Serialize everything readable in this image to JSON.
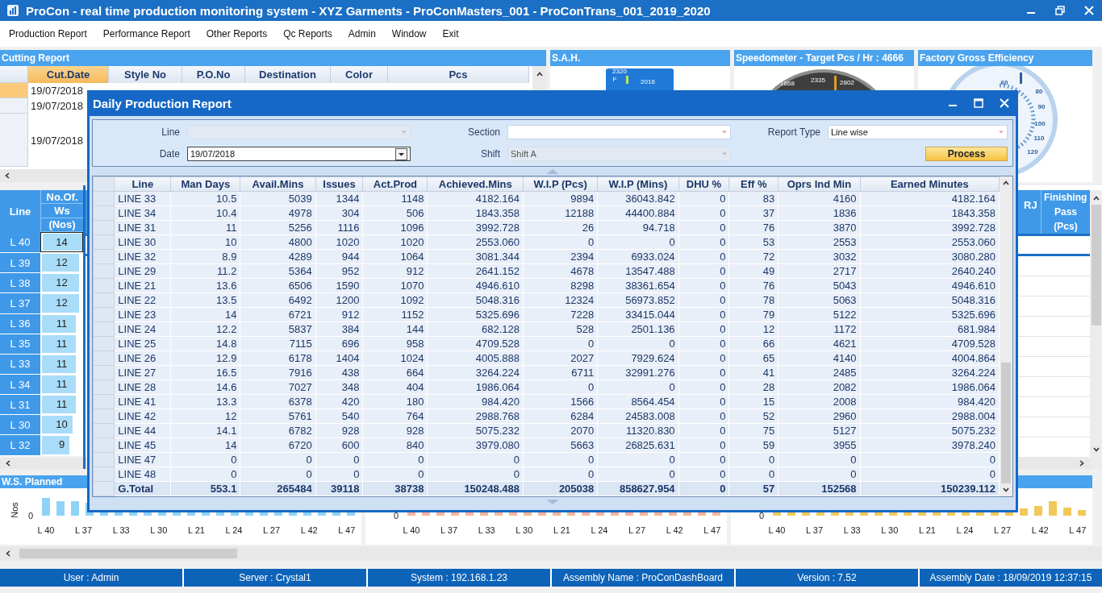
{
  "window": {
    "title": "ProCon - real time production monitoring system - XYZ Garments - ProConMasters_001 - ProConTrans_001_2019_2020"
  },
  "menu": [
    "Production Report",
    "Performance Report",
    "Other Reports",
    "Qc Reports",
    "Admin",
    "Window",
    "Exit"
  ],
  "cutting_report": {
    "title": "Cutting Report",
    "columns": [
      {
        "label": "Cut.Date",
        "selected": true
      },
      {
        "label": "Style No",
        "selected": false
      },
      {
        "label": "P.O.No",
        "selected": false
      },
      {
        "label": "Destination",
        "selected": false
      },
      {
        "label": "Color",
        "selected": false
      },
      {
        "label": "Pcs",
        "selected": false
      }
    ],
    "rows": [
      {
        "cut_date": "19/07/2018",
        "selected": true
      },
      {
        "cut_date": "19/07/2018",
        "selected": false
      },
      {
        "cut_date": "19/07/2018",
        "selected": false
      }
    ]
  },
  "gauges": [
    {
      "kind": "sah",
      "title": "S.A.H.",
      "labels": [
        "2320",
        "F",
        "2016"
      ]
    },
    {
      "kind": "speedometer",
      "title": "Speedometer - Target Pcs / Hr : 4666",
      "labels": [
        "1868",
        "2335",
        "2802"
      ]
    },
    {
      "kind": "efficiency",
      "title": "Factory Gross Efficiency",
      "labels": [
        "60",
        "80",
        "90",
        "100",
        "110",
        "120"
      ]
    }
  ],
  "line_table": {
    "line_header": "Line",
    "ws_header": [
      "No.Of.",
      "Ws",
      "(Nos)"
    ],
    "rows": [
      {
        "line": "L 40",
        "ws": "14",
        "level": 1,
        "selected": true
      },
      {
        "line": "L 39",
        "ws": "12",
        "level": 0.86,
        "selected": false
      },
      {
        "line": "L 38",
        "ws": "12",
        "level": 0.86,
        "selected": false
      },
      {
        "line": "L 37",
        "ws": "12",
        "level": 0.86,
        "selected": false
      },
      {
        "line": "L 36",
        "ws": "11",
        "level": 0.79,
        "selected": false
      },
      {
        "line": "L 35",
        "ws": "11",
        "level": 0.79,
        "selected": false
      },
      {
        "line": "L 33",
        "ws": "11",
        "level": 0.79,
        "selected": false
      },
      {
        "line": "L 34",
        "ws": "11",
        "level": 0.79,
        "selected": false
      },
      {
        "line": "L 31",
        "ws": "11",
        "level": 0.79,
        "selected": false
      },
      {
        "line": "L 30",
        "ws": "10",
        "level": 0.71,
        "selected": false
      },
      {
        "line": "L 32",
        "ws": "9",
        "level": 0.64,
        "selected": false
      }
    ]
  },
  "finishing_table": {
    "headers": [
      "RJ",
      "Finishing",
      "Pass",
      "(Pcs)"
    ]
  },
  "charts": [
    {
      "title": "W.S. Planned",
      "y_label": "Nos",
      "zero": "0",
      "color": "#8ed3f7",
      "x_labels": [
        "L 40",
        "L 37",
        "L 33",
        "L 30",
        "L 21",
        "L 24",
        "L 27",
        "L 42",
        "L 47"
      ]
    },
    {
      "zero": "0",
      "color": "#f8b49a",
      "x_labels": [
        "L 40",
        "L 37",
        "L 33",
        "L 30",
        "L 21",
        "L 24",
        "L 27",
        "L 42",
        "L 47"
      ]
    },
    {
      "zero": "0",
      "color": "#f2c85a",
      "x_labels": [
        "L 40",
        "L 37",
        "L 33",
        "L 30",
        "L 21",
        "L 24",
        "L 27",
        "L 42",
        "L 47"
      ]
    }
  ],
  "dialog": {
    "title": "Daily Production Report",
    "filters": [
      {
        "label": "Line",
        "kind": "combo",
        "disabled": true
      },
      {
        "label": "Section",
        "kind": "combo",
        "disabled": false
      },
      {
        "label": "Report Type",
        "kind": "combo",
        "value": "Line wise",
        "disabled": false
      },
      {
        "label": "Date",
        "kind": "date",
        "value": "19/07/2018",
        "disabled": false
      },
      {
        "label": "Shift",
        "kind": "combo",
        "value": "Shift A",
        "disabled": true
      }
    ],
    "process_button": "Process",
    "columns": [
      "Line",
      "Man Days",
      "Avail.Mins",
      "Issues",
      "Act.Prod",
      "Achieved.Mins",
      "W.I.P (Pcs)",
      "W.I.P (Mins)",
      "DHU %",
      "Eff %",
      "Oprs Ind Min",
      "Earned Minutes"
    ],
    "rows": [
      [
        "LINE 33",
        "10.5",
        "5039",
        "1344",
        "1148",
        "4182.164",
        "9894",
        "36043.842",
        "0",
        "83",
        "4160",
        "4182.164"
      ],
      [
        "LINE 34",
        "10.4",
        "4978",
        "304",
        "506",
        "1843.358",
        "12188",
        "44400.884",
        "0",
        "37",
        "1836",
        "1843.358"
      ],
      [
        "LINE 31",
        "11",
        "5256",
        "1116",
        "1096",
        "3992.728",
        "26",
        "94.718",
        "0",
        "76",
        "3870",
        "3992.728"
      ],
      [
        "LINE 30",
        "10",
        "4800",
        "1020",
        "1020",
        "2553.060",
        "0",
        "0",
        "0",
        "53",
        "2553",
        "2553.060"
      ],
      [
        "LINE 32",
        "8.9",
        "4289",
        "944",
        "1064",
        "3081.344",
        "2394",
        "6933.024",
        "0",
        "72",
        "3032",
        "3080.280"
      ],
      [
        "LINE 29",
        "11.2",
        "5364",
        "952",
        "912",
        "2641.152",
        "4678",
        "13547.488",
        "0",
        "49",
        "2717",
        "2640.240"
      ],
      [
        "LINE 21",
        "13.6",
        "6506",
        "1590",
        "1070",
        "4946.610",
        "8298",
        "38361.654",
        "0",
        "76",
        "5043",
        "4946.610"
      ],
      [
        "LINE 22",
        "13.5",
        "6492",
        "1200",
        "1092",
        "5048.316",
        "12324",
        "56973.852",
        "0",
        "78",
        "5063",
        "5048.316"
      ],
      [
        "LINE 23",
        "14",
        "6721",
        "912",
        "1152",
        "5325.696",
        "7228",
        "33415.044",
        "0",
        "79",
        "5122",
        "5325.696"
      ],
      [
        "LINE 24",
        "12.2",
        "5837",
        "384",
        "144",
        "682.128",
        "528",
        "2501.136",
        "0",
        "12",
        "1172",
        "681.984"
      ],
      [
        "LINE 25",
        "14.8",
        "7115",
        "696",
        "958",
        "4709.528",
        "0",
        "0",
        "0",
        "66",
        "4621",
        "4709.528"
      ],
      [
        "LINE 26",
        "12.9",
        "6178",
        "1404",
        "1024",
        "4005.888",
        "2027",
        "7929.624",
        "0",
        "65",
        "4140",
        "4004.864"
      ],
      [
        "LINE 27",
        "16.5",
        "7916",
        "438",
        "664",
        "3264.224",
        "6711",
        "32991.276",
        "0",
        "41",
        "2485",
        "3264.224"
      ],
      [
        "LINE 28",
        "14.6",
        "7027",
        "348",
        "404",
        "1986.064",
        "0",
        "0",
        "0",
        "28",
        "2082",
        "1986.064"
      ],
      [
        "LINE 41",
        "13.3",
        "6378",
        "420",
        "180",
        "984.420",
        "1566",
        "8564.454",
        "0",
        "15",
        "2008",
        "984.420"
      ],
      [
        "LINE 42",
        "12",
        "5761",
        "540",
        "764",
        "2988.768",
        "6284",
        "24583.008",
        "0",
        "52",
        "2960",
        "2988.004"
      ],
      [
        "LINE 44",
        "14.1",
        "6782",
        "928",
        "928",
        "5075.232",
        "2070",
        "11320.830",
        "0",
        "75",
        "5127",
        "5075.232"
      ],
      [
        "LINE 45",
        "14",
        "6720",
        "600",
        "840",
        "3979.080",
        "5663",
        "26825.631",
        "0",
        "59",
        "3955",
        "3978.240"
      ],
      [
        "LINE 47",
        "0",
        "0",
        "0",
        "0",
        "0",
        "0",
        "0",
        "0",
        "0",
        "0",
        "0"
      ],
      [
        "LINE 48",
        "0",
        "0",
        "0",
        "0",
        "0",
        "0",
        "0",
        "0",
        "0",
        "0",
        "0"
      ]
    ],
    "total": [
      "G.Total",
      "553.1",
      "265484",
      "39118",
      "38738",
      "150248.488",
      "205038",
      "858627.954",
      "0",
      "57",
      "152568",
      "150239.112"
    ]
  },
  "status_bar": [
    "User : Admin",
    "Server : Crystal1",
    "System : 192.168.1.23",
    "Assembly Name : ProConDashBoard",
    "Version : 7.52",
    "Assembly Date : 18/09/2019 12:37:15"
  ]
}
